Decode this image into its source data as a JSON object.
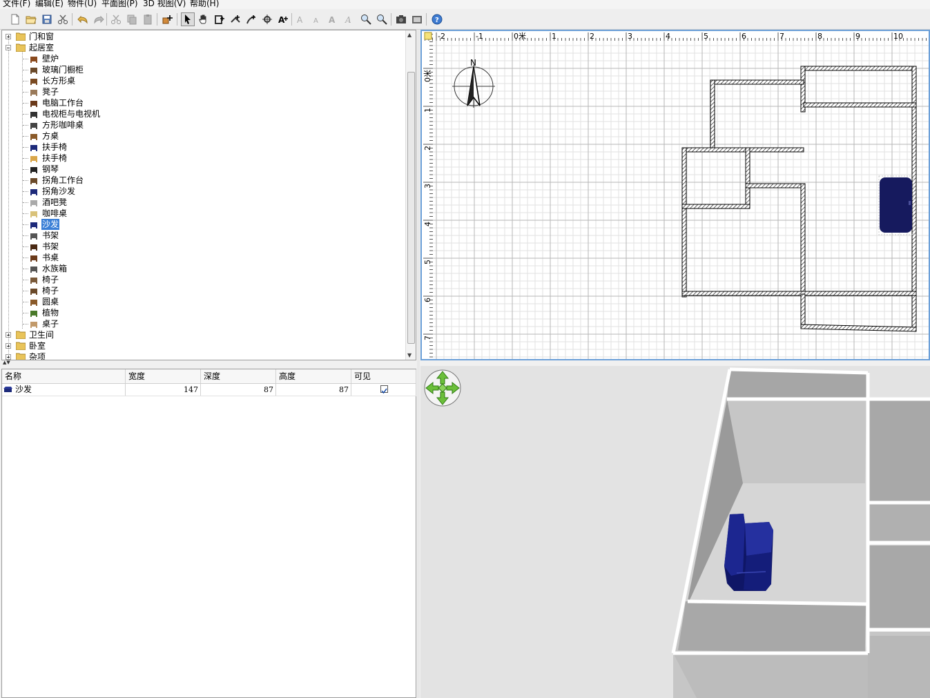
{
  "menu": [
    "文件(F)",
    "编辑(E)",
    "物件(U)",
    "平面图(P)",
    "3D 视图(V)",
    "帮助(H)"
  ],
  "toolbar": {
    "buttons": [
      "new-file-icon",
      "open-folder-icon",
      "save-icon",
      "cut-icon",
      "undo-icon",
      "redo-icon",
      "cut2-icon",
      "copy-icon",
      "paste-icon",
      "add-furniture-icon",
      "select-mode-icon",
      "pan-icon",
      "create-walls-icon",
      "create-rooms-icon",
      "create-dimension-icon",
      "create-labels-icon",
      "add-text-icon",
      "increase-text-icon",
      "decrease-text-icon",
      "bold-text-icon",
      "italic-text-icon",
      "zoom-in-icon",
      "zoom-out-icon",
      "create-photo-icon",
      "create-video-icon",
      "help-icon"
    ]
  },
  "tree": {
    "categories": [
      {
        "label": "门和窗",
        "expanded": false
      },
      {
        "label": "起居室",
        "expanded": true,
        "items": [
          "壁炉",
          "玻璃门橱柜",
          "长方形桌",
          "凳子",
          "电脑工作台",
          "电视柜与电视机",
          "方形咖啡桌",
          "方桌",
          "扶手椅",
          "扶手椅",
          "钢琴",
          "拐角工作台",
          "拐角沙发",
          "酒吧凳",
          "咖啡桌",
          "沙发",
          "书架",
          "书架",
          "书桌",
          "水族箱",
          "椅子",
          "椅子",
          "圆桌",
          "植物",
          "桌子"
        ]
      },
      {
        "label": "卫生间",
        "expanded": false
      },
      {
        "label": "卧室",
        "expanded": false
      },
      {
        "label": "杂项",
        "expanded": false
      }
    ],
    "selected_item": "沙发"
  },
  "furniture_table": {
    "columns": [
      "名称",
      "宽度",
      "深度",
      "高度",
      "可见"
    ],
    "rows": [
      {
        "name": "沙发",
        "width": "147",
        "depth": "87",
        "height": "87",
        "visible": true
      }
    ]
  },
  "plan": {
    "x_ruler": [
      "-2",
      "-1",
      "0米",
      "1",
      "2",
      "3",
      "4",
      "5",
      "6",
      "7",
      "8",
      "9",
      "10"
    ],
    "y_ruler": [
      "0米",
      "1",
      "2",
      "3",
      "4",
      "5",
      "6",
      "7"
    ],
    "compass_label": "N",
    "colors": {
      "sofa": "#161a5e",
      "grid_major": "#b5b5b5",
      "grid_minor": "#e2e2e2"
    }
  }
}
